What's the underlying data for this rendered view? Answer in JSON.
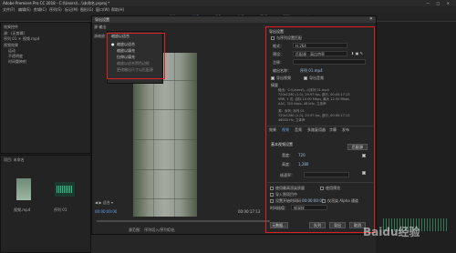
{
  "app": {
    "title": "Adobe Premiere Pro CC 2018 - C:\\\\Users\\\\...\\\\未命名.prproj *",
    "window_controls": "— □ ✕"
  },
  "menu": [
    "文件(F)",
    "编辑(E)",
    "剪辑(C)",
    "序列(S)",
    "标记(M)",
    "图形(G)",
    "窗口(W)",
    "帮助(H)"
  ],
  "workspaces": [
    {
      "label": "组件",
      "active": false
    },
    {
      "label": "编辑",
      "active": true
    },
    {
      "label": "颜色",
      "active": false
    },
    {
      "label": "效果",
      "active": false
    },
    {
      "label": "音频",
      "active": false
    },
    {
      "label": "图形",
      "active": false
    },
    {
      "label": "库",
      "active": false
    }
  ],
  "left_panel": {
    "tab": "效果控件",
    "lines": [
      "源：(无剪辑)",
      "序列 01 ＊ 视频.mp4",
      "视频效果",
      "运动",
      "不透明度",
      "时间重映射"
    ],
    "project_tab": "项目: 未命名",
    "project_items": [
      "视频.mp4",
      "序列 01"
    ]
  },
  "dialog": {
    "title": "导出设置",
    "close": "✕",
    "source_tabs": "源   输出",
    "source_scaling_label": "源缩放：",
    "dropdown": {
      "header": "缩放以适合",
      "items": [
        {
          "label": "缩放以适合",
          "selected": true
        },
        {
          "label": "缩放以填充",
          "selected": false
        },
        {
          "label": "拉伸以填充",
          "selected": false
        },
        {
          "label": "缩放以适合黑色边框",
          "selected": false,
          "dim": true
        },
        {
          "label": "更改输出尺寸以匹配源",
          "selected": false,
          "dim": true
        }
      ]
    },
    "timecode_left": "00:00:00:00",
    "timecode_right": "00:00:17:13",
    "source_range_label": "源范围：",
    "source_range_value": "序列切入/序列切出",
    "controls": "◀ ▶  适合 ▾",
    "playhead_percent": 0
  },
  "export": {
    "section_title": "导出设置",
    "match_sequence_label": "与序列设置匹配",
    "format_label": "格式：",
    "format_value": "H.264",
    "preset_label": "预设：",
    "preset_value": "匹配源 - 高比特率",
    "comment_label": "注释：",
    "output_name_label": "输出名称：",
    "output_name_value": "序列 01.mp4",
    "export_video_label": "导出视频",
    "export_audio_label": "导出音频",
    "summary_label": "摘要",
    "summary_lines": [
      "输出：C:\\\\Users\\\\...\\\\序列 01.mp4",
      "720x1280 (1.0), 29.97 fps, 逐行, 00:00:17:13",
      "VBR, 1 次, 目标 10.00 Mbps, 最大 12.00 Mbps",
      "AAC, 320 kbps, 48 kHz, 立体声",
      "源：序列, 序列 01",
      "720x1280 (1.0), 29.97 fps, 逐行, 00:00:17:13",
      "48000 Hz, 立体声"
    ],
    "tabs": [
      "效果",
      "视频",
      "音频",
      "多路复用器",
      "字幕",
      "发布"
    ],
    "basic_video_label": "基本视频设置",
    "match_source_button": "匹配源",
    "width_label": "宽度：",
    "width_value": "720",
    "height_label": "高度：",
    "height_value": "1,280",
    "frame_rate_label": "帧速率：",
    "max_render_label": "使用最高渲染质量",
    "use_previews_label": "使用预览",
    "import_project_label": "导入到项目中",
    "start_timecode_label": "设置开始时间码",
    "start_timecode_value": "00:00:00:00",
    "alpha_label": "仅渲染 Alpha 通道",
    "interpolation_label": "时间插值：",
    "interpolation_value": "帧采样",
    "metadata_button": "元数据...",
    "queue_button": "队列",
    "export_button": "导出",
    "cancel_button": "取消"
  },
  "colors": {
    "accent": "#5fa7f3",
    "highlight_box": "#e02020"
  },
  "watermark": "Baidu经验"
}
